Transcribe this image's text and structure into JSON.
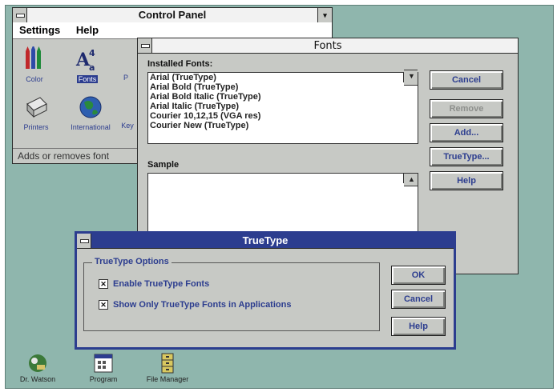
{
  "control_panel": {
    "title": "Control Panel",
    "maximize_glyph": "▾",
    "menu": [
      "Settings",
      "Help"
    ],
    "icons": [
      {
        "label": "Color",
        "icon": "color-crayons-icon"
      },
      {
        "label": "Fonts",
        "icon": "fonts-icon"
      },
      {
        "label": "P",
        "icon": "ports-icon"
      },
      {
        "label": "Printers",
        "icon": "printers-icon"
      },
      {
        "label": "International",
        "icon": "international-globe-icon"
      },
      {
        "label": "Key",
        "icon": "keyboard-icon"
      }
    ],
    "status": "Adds or removes font"
  },
  "fonts": {
    "title": "Fonts",
    "installed_label": "Installed Fonts:",
    "installed": [
      "Arial (TrueType)",
      "Arial Bold (TrueType)",
      "Arial Bold Italic (TrueType)",
      "Arial Italic (TrueType)",
      "Courier 10,12,15 (VGA res)",
      "Courier New (TrueType)"
    ],
    "sample_label": "Sample",
    "buttons": {
      "cancel": "Cancel",
      "remove": "Remove",
      "add": "Add...",
      "truetype": "TrueType...",
      "help": "Help"
    }
  },
  "truetype": {
    "title": "TrueType",
    "group_title": "TrueType Options",
    "options": [
      {
        "label": "Enable TrueType Fonts",
        "checked": true
      },
      {
        "label": "Show Only TrueType Fonts in Applications",
        "checked": true
      }
    ],
    "buttons": {
      "ok": "OK",
      "cancel": "Cancel",
      "help": "Help"
    }
  },
  "desktop_icons": [
    {
      "label": "Dr. Watson",
      "icon": "dr-watson-icon"
    },
    {
      "label": "Program",
      "icon": "program-manager-icon"
    },
    {
      "label": "File Manager",
      "icon": "file-manager-icon"
    }
  ],
  "colors": {
    "active_title": "#2c3d8f",
    "desktop": "#8fb6ad",
    "face": "#c7c9c5"
  }
}
